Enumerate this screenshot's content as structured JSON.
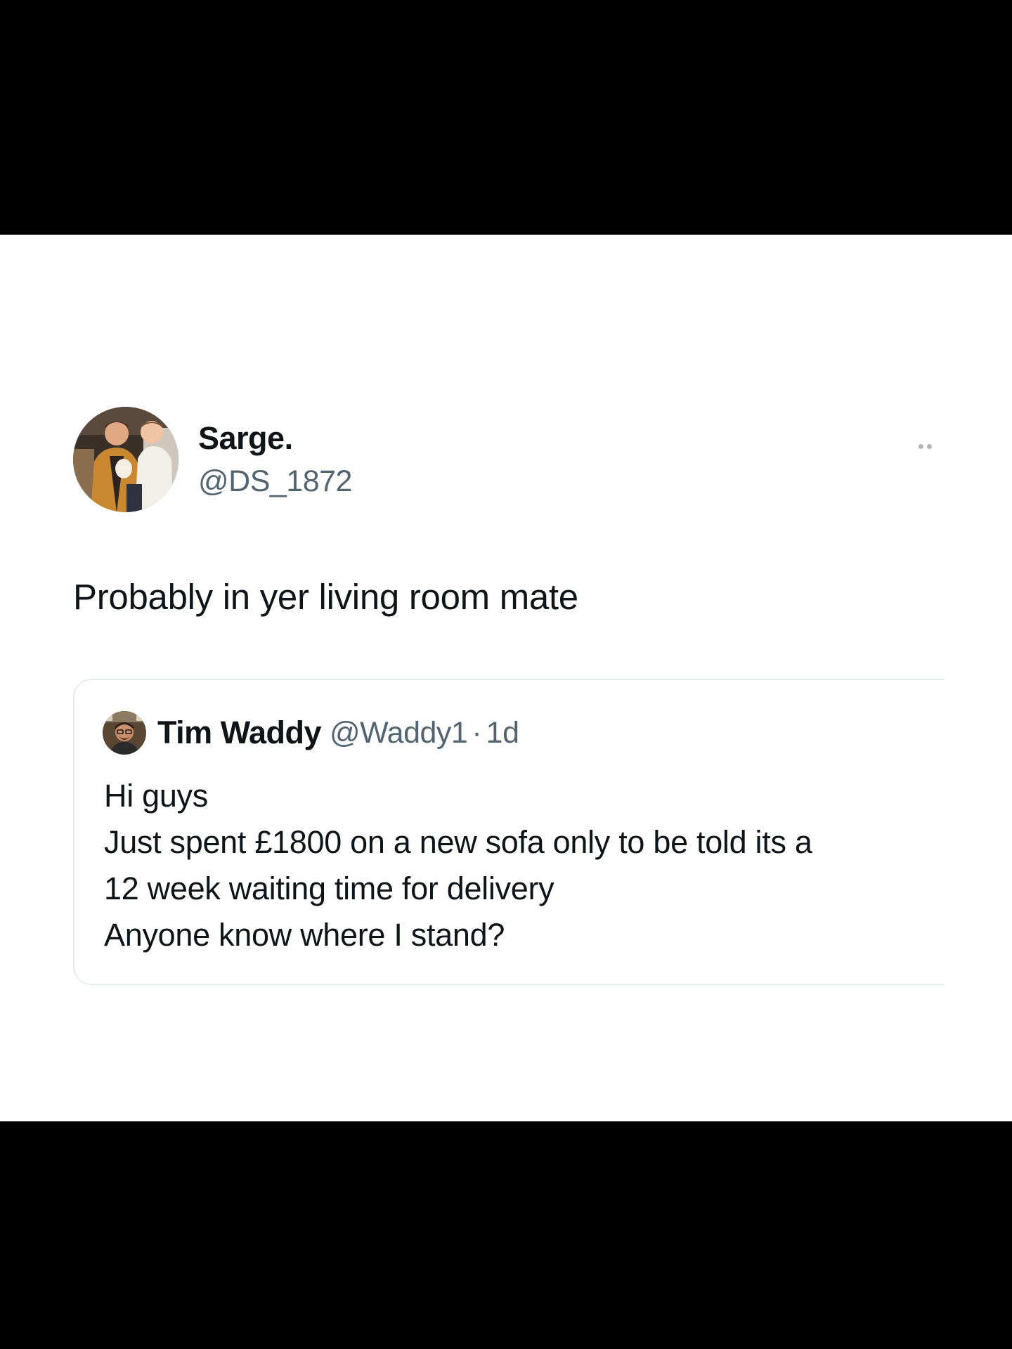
{
  "tweet": {
    "author": {
      "display_name": "Sarge.",
      "handle": "@DS_1872",
      "avatar_icon": "profile-photo-two-men"
    },
    "more_icon": "more-dots-icon",
    "text": "Probably in yer living room mate",
    "quoted_tweet": {
      "author": {
        "display_name": "Tim Waddy",
        "handle": "@Waddy1",
        "avatar_icon": "profile-photo-man-glasses"
      },
      "separator": "·",
      "time": "1d",
      "lines": [
        "Hi guys",
        "Just spent £1800 on a new sofa only to be told its a",
        "12 week waiting time for delivery",
        "Anyone know where I stand?"
      ]
    }
  },
  "colors": {
    "page_background": "#000000",
    "card_background": "#ffffff",
    "primary_text": "#0f1419",
    "secondary_text": "#536471",
    "border": "#e8ecee"
  }
}
